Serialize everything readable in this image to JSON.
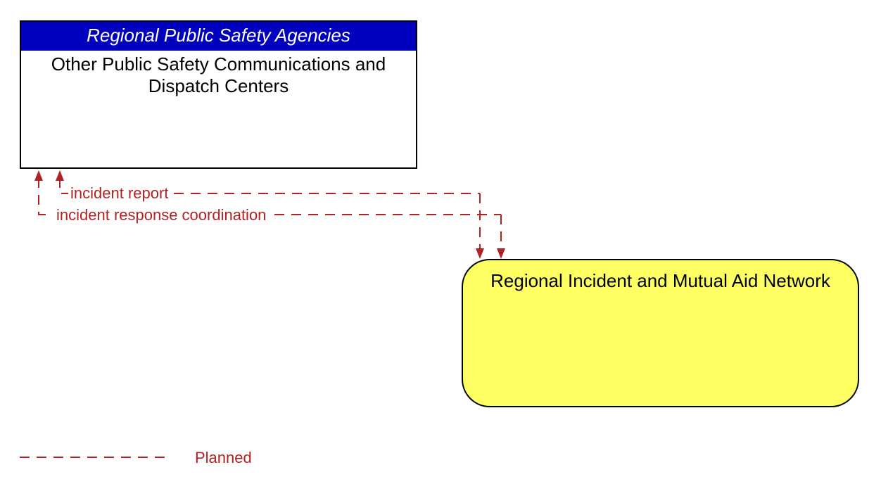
{
  "entities": {
    "agency": {
      "header": "Regional Public Safety Agencies",
      "title": "Other Public Safety Communications and Dispatch Centers"
    },
    "network": {
      "title": "Regional Incident and Mutual Aid Network"
    }
  },
  "flows": {
    "incident_report": "incident report",
    "incident_response_coord": "incident response coordination"
  },
  "legend": {
    "planned": "Planned"
  },
  "colors": {
    "header_bg": "#0000BE",
    "network_bg": "#FDFF62",
    "flow_line": "#B22222"
  }
}
